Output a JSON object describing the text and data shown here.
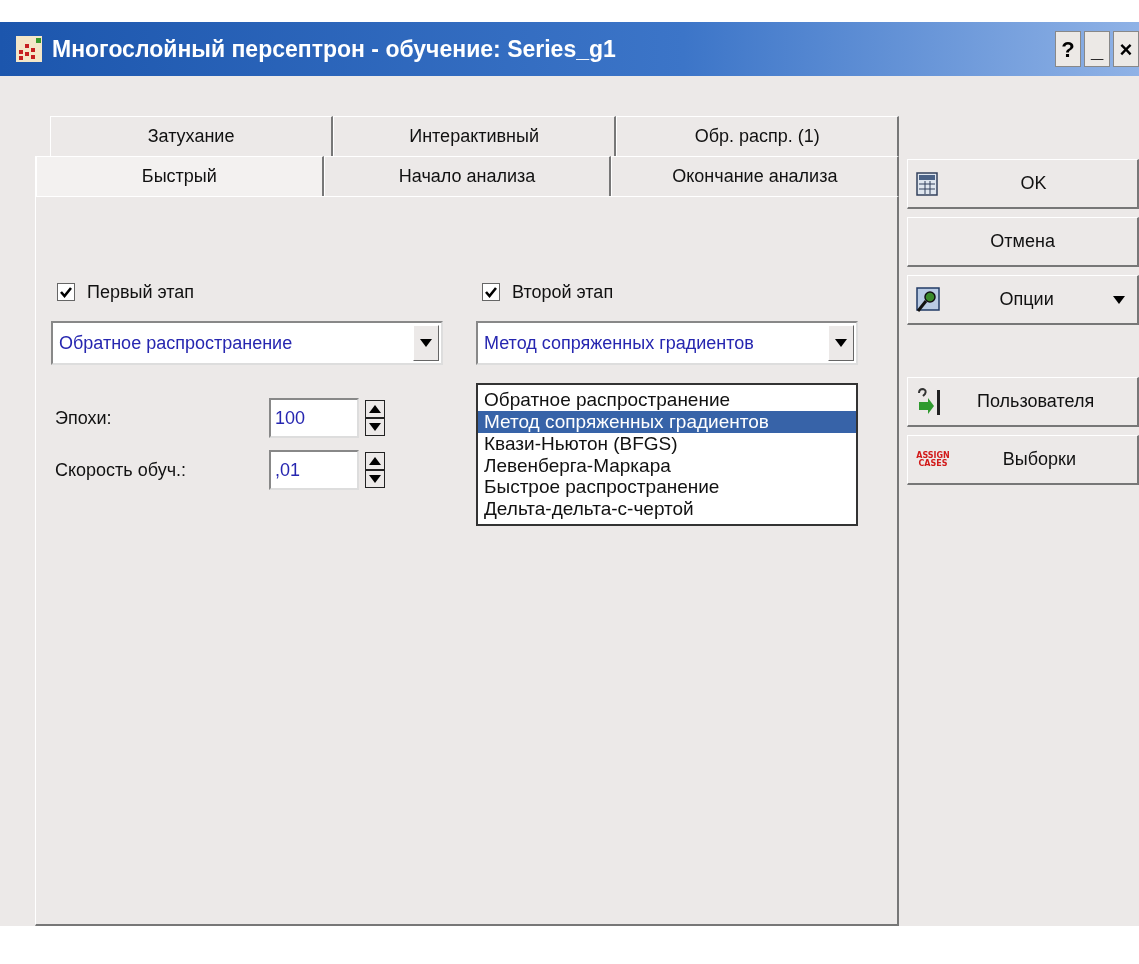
{
  "window": {
    "title": "Многослойный персептрон - обучение: Series_g1",
    "title_buttons": [
      "?",
      "_",
      "×"
    ]
  },
  "tab_rows": [
    [
      {
        "label": "Затухание",
        "selected": false
      },
      {
        "label": "Интерактивный",
        "selected": false
      },
      {
        "label": "Обр. распр. (1)",
        "selected": false
      }
    ],
    [
      {
        "label": "Быстрый",
        "selected": true
      },
      {
        "label": "Начало анализа",
        "selected": false
      },
      {
        "label": "Окончание анализа",
        "selected": false
      }
    ]
  ],
  "first_stage": {
    "label": "Первый этап",
    "checked": true,
    "value": "Обратное распространение"
  },
  "epochs": {
    "label": "Эпохи:",
    "value": "100"
  },
  "learning_rate": {
    "label": "Скорость обуч.:",
    "value": ",01"
  },
  "second_stage": {
    "label": "Второй этап",
    "checked": true,
    "value": "Метод сопряженных градиентов",
    "expanded": true,
    "options": [
      {
        "label": "Обратное распространение",
        "selected": false
      },
      {
        "label": "Метод сопряженных градиентов",
        "selected": true
      },
      {
        "label": "Квази-Ньютон (BFGS)",
        "selected": false
      },
      {
        "label": "Левенберга-Маркара",
        "selected": false
      },
      {
        "label": "Быстрое распространение",
        "selected": false
      },
      {
        "label": "Дельта-дельта-с-чертой",
        "selected": false
      }
    ]
  },
  "buttons": [
    {
      "label": "OK",
      "kind": "grid"
    },
    {
      "label": "Отмена",
      "kind": "plain"
    },
    {
      "label": "Опции",
      "kind": "magnifier-menu"
    },
    {
      "label": "Пользователя",
      "kind": "user"
    },
    {
      "label": "Выборки",
      "kind": "assign",
      "icon_text": [
        "ASSIGN",
        "CASES"
      ]
    }
  ]
}
